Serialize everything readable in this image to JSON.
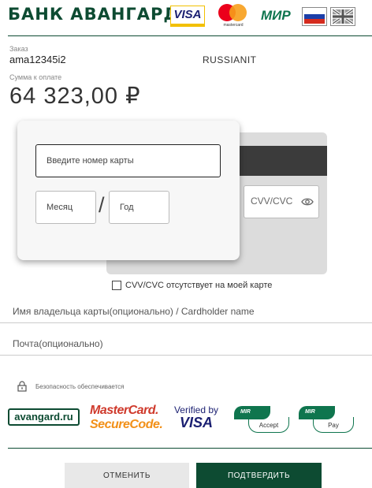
{
  "header": {
    "bank_name": "БАНК АВАНГАРД",
    "visa_text": "VISA",
    "mastercard_text": "mastercard",
    "mir_text": "МИР",
    "languages": [
      "ru",
      "en"
    ]
  },
  "order": {
    "label": "Заказ",
    "value": "ama12345i2",
    "merchant": "RUSSIANIT"
  },
  "amount": {
    "label": "Сумма к оплате",
    "value": "64 323,00 ₽"
  },
  "card": {
    "number_placeholder": "Введите номер карты",
    "month_placeholder": "Месяц",
    "year_placeholder": "Год",
    "slash": "/",
    "cvv_placeholder": "CVV/CVC"
  },
  "no_cvv_label": "CVV/CVC отсутствует на моей карте",
  "holder_placeholder": "Имя владельца карты(опционально) / Cardholder name",
  "email_placeholder": "Почта(опционально)",
  "security_label": "Безопасность обеспечивается",
  "logos": {
    "avangard": "avangard.ru",
    "mc_secure_l1": "MasterCard.",
    "mc_secure_l2": "SecureCode.",
    "vbv_l1": "Verified by",
    "vbv_l2": "VISA",
    "mir_accept_top": "MIR",
    "mir_accept_bottom": "Accept",
    "mir_pay_top": "MIR",
    "mir_pay_bottom": "Pay"
  },
  "buttons": {
    "cancel": "ОТМЕНИТЬ",
    "confirm": "ПОДТВЕРДИТЬ"
  },
  "colors": {
    "brand_green": "#0d4b32",
    "mir_green": "#0f754e"
  }
}
